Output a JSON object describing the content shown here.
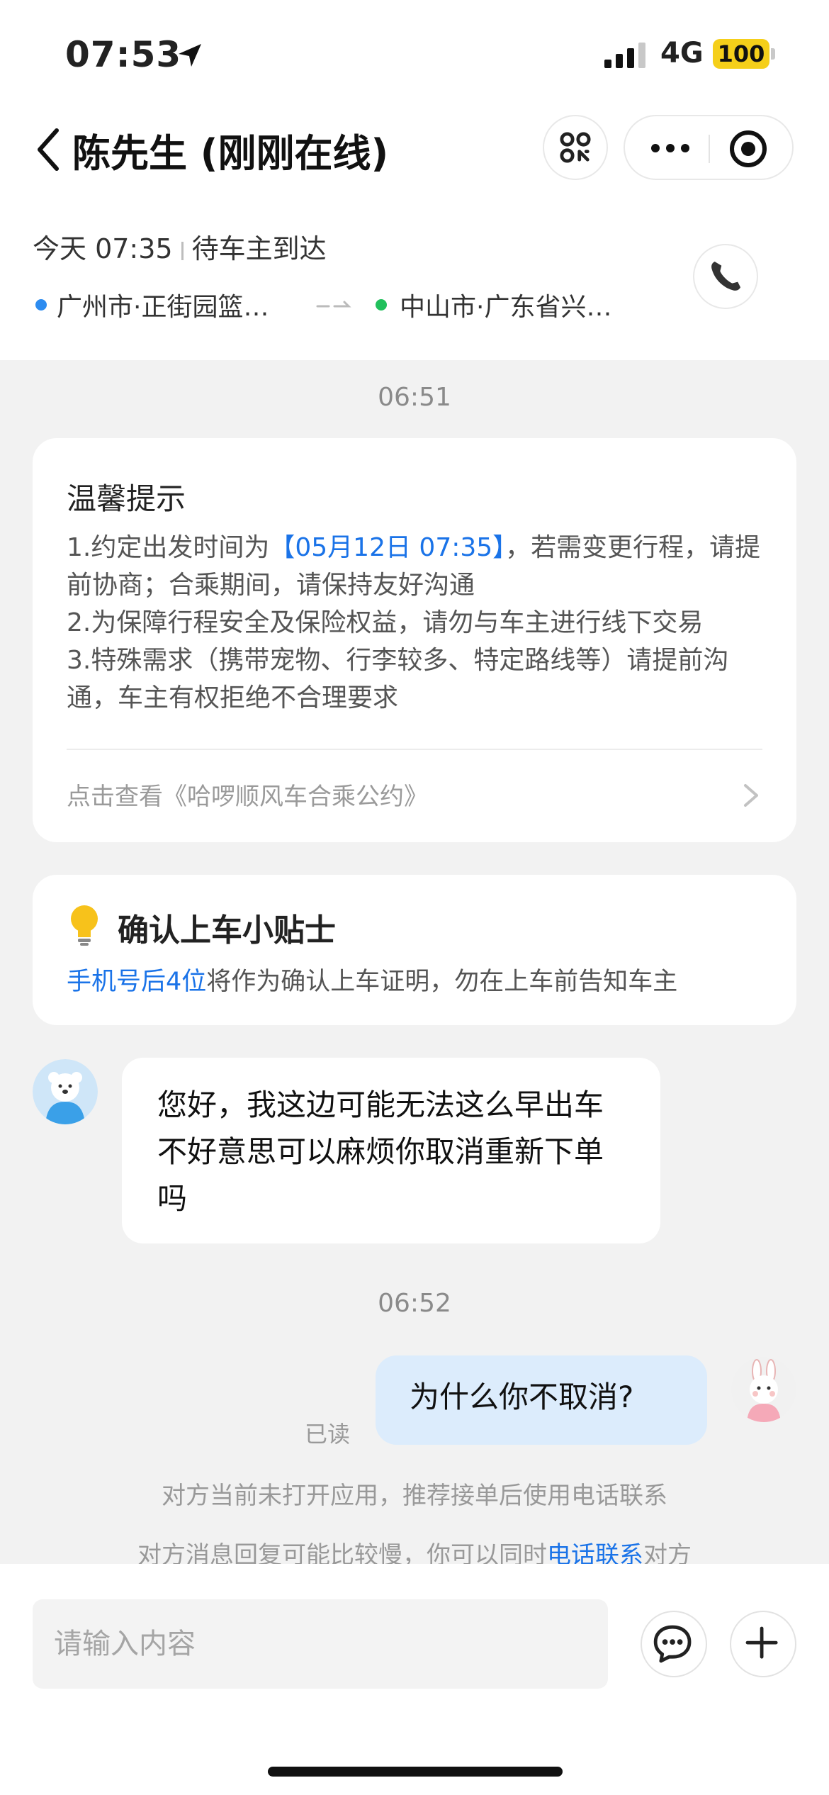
{
  "status_bar": {
    "time": "07:53",
    "network": "4G",
    "battery": "100"
  },
  "header": {
    "title": "陈先生 (刚刚在线)",
    "trip_time": "今天 07:35",
    "trip_status": "待车主到达",
    "origin": "广州市·正街园篮…",
    "destination": "中山市·广东省兴…"
  },
  "chat": {
    "timestamp_1": "06:51",
    "notice": {
      "title": "温馨提示",
      "line1_prefix": "1.约定出发时间为",
      "line1_highlight": "【05月12日 07:35】",
      "line1_suffix": "，若需变更行程，请提前协商；合乘期间，请保持友好沟通",
      "line2": "2.为保障行程安全及保险权益，请勿与车主进行线下交易",
      "line3": "3.特殊需求（携带宠物、行李较多、特定路线等）请提前沟通，车主有权拒绝不合理要求",
      "link": "点击查看《哈啰顺风车合乘公约》"
    },
    "tip": {
      "title": "确认上车小贴士",
      "highlight": "手机号后4位",
      "text": "将作为确认上车证明，勿在上车前告知车主"
    },
    "incoming_message": "您好，我这边可能无法这么早出车不好意思可以麻烦你取消重新下单吗",
    "timestamp_2": "06:52",
    "outgoing_message": "为什么你不取消?",
    "read_status": "已读",
    "system_line_1": "对方当前未打开应用，推荐接单后使用电话联系",
    "system_line_2_prefix": "对方消息回复可能比较慢，你可以同时",
    "system_line_2_link": "电话联系",
    "system_line_2_suffix": "对方"
  },
  "input_bar": {
    "placeholder": "请输入内容"
  },
  "colors": {
    "accent_blue": "#1a73e8",
    "outgoing_bubble": "#dcecfc",
    "battery_yellow": "#f5cf1a"
  }
}
